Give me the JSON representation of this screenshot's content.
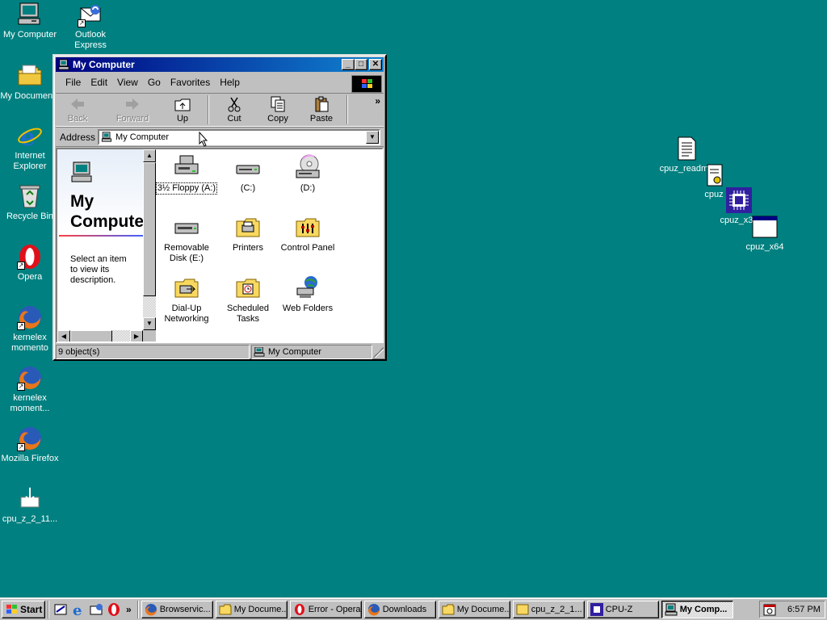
{
  "desktop": {
    "icons": [
      {
        "label": "My Computer"
      },
      {
        "label": "Outlook Express"
      },
      {
        "label": "My Documents"
      },
      {
        "label": "Internet Explorer"
      },
      {
        "label": "Recycle Bin"
      },
      {
        "label": "Opera"
      },
      {
        "label": "kernelex momento"
      },
      {
        "label": "kernelex moment..."
      },
      {
        "label": "Mozilla Firefox"
      },
      {
        "label": "cpu_z_2_11..."
      },
      {
        "label": "cpuz_readme"
      },
      {
        "label": "cpuz"
      },
      {
        "label": "cpuz_x32"
      },
      {
        "label": "cpuz_x64"
      }
    ]
  },
  "window": {
    "title": "My Computer",
    "menu": [
      "File",
      "Edit",
      "View",
      "Go",
      "Favorites",
      "Help"
    ],
    "toolbar": {
      "back": "Back",
      "forward": "Forward",
      "up": "Up",
      "cut": "Cut",
      "copy": "Copy",
      "paste": "Paste",
      "more": "»"
    },
    "address": {
      "label": "Address",
      "value": "My Computer"
    },
    "left_pane": {
      "title": "My Computer",
      "description": "Select an item to view its description."
    },
    "items": [
      {
        "label": "3½ Floppy (A:)",
        "icon": "floppy-drive-icon"
      },
      {
        "label": "(C:)",
        "icon": "hard-drive-icon"
      },
      {
        "label": "(D:)",
        "icon": "cd-drive-icon"
      },
      {
        "label": "Removable Disk (E:)",
        "icon": "removable-disk-icon"
      },
      {
        "label": "Printers",
        "icon": "printers-folder-icon"
      },
      {
        "label": "Control Panel",
        "icon": "control-panel-icon"
      },
      {
        "label": "Dial-Up Networking",
        "icon": "dialup-networking-icon"
      },
      {
        "label": "Scheduled Tasks",
        "icon": "scheduled-tasks-icon"
      },
      {
        "label": "Web Folders",
        "icon": "web-folders-icon"
      }
    ],
    "status": {
      "objects": "9 object(s)",
      "location": "My Computer"
    }
  },
  "taskbar": {
    "start": "Start",
    "quick_more": "»",
    "tasks": [
      {
        "label": "Browservic..."
      },
      {
        "label": "My Docume..."
      },
      {
        "label": "Error - Opera"
      },
      {
        "label": "Downloads"
      },
      {
        "label": "My Docume..."
      },
      {
        "label": "cpu_z_2_1..."
      },
      {
        "label": "CPU-Z"
      },
      {
        "label": "My Comp..."
      }
    ],
    "clock": "6:57 PM"
  },
  "colors": {
    "desktop": "#008080",
    "titlebar_start": "#000080",
    "titlebar_end": "#1084d0"
  }
}
